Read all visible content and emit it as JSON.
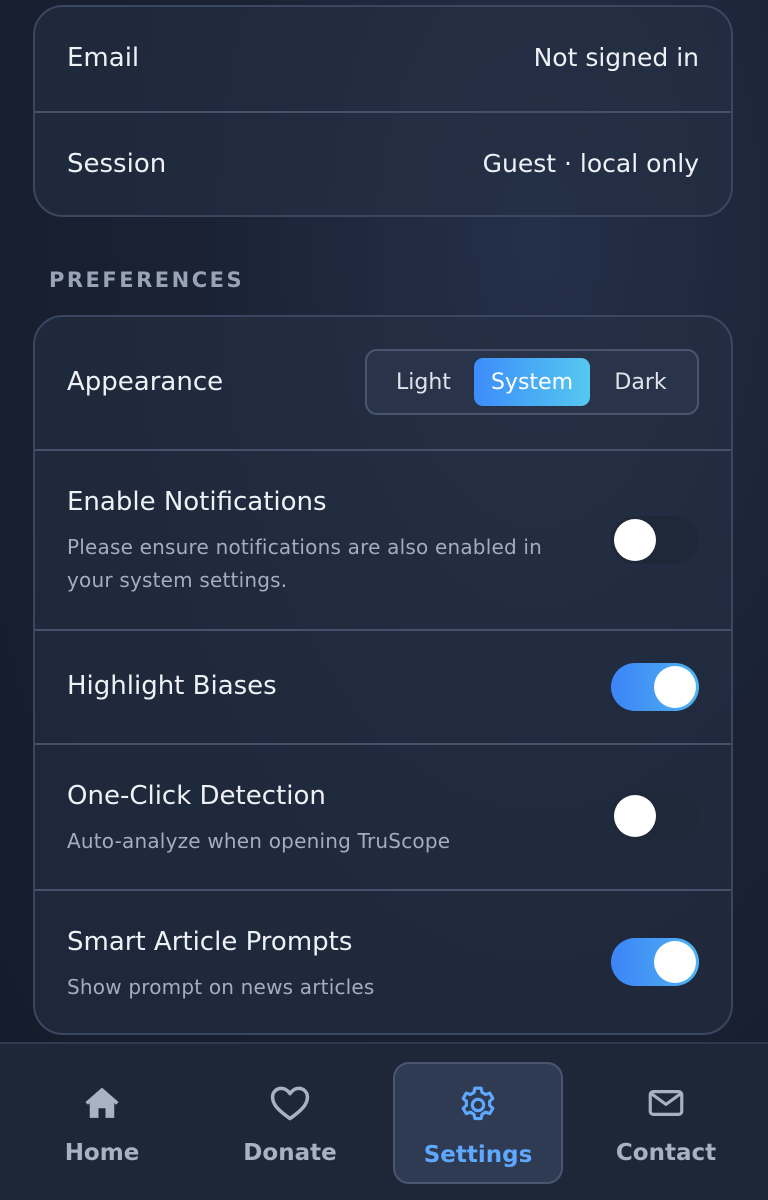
{
  "account": {
    "email_label": "Email",
    "email_value": "Not signed in",
    "session_label": "Session",
    "session_value": "Guest · local only"
  },
  "preferences": {
    "heading": "PREFERENCES",
    "appearance": {
      "label": "Appearance",
      "options": [
        "Light",
        "System",
        "Dark"
      ],
      "selected": "System"
    },
    "notifications": {
      "label": "Enable Notifications",
      "description": "Please ensure notifications are also enabled in your system settings.",
      "enabled": false
    },
    "highlight_biases": {
      "label": "Highlight Biases",
      "enabled": true
    },
    "one_click": {
      "label": "One-Click Detection",
      "description": "Auto-analyze when opening TruScope",
      "enabled": false
    },
    "smart_prompts": {
      "label": "Smart Article Prompts",
      "description": "Show prompt on news articles",
      "enabled": true
    }
  },
  "nav": {
    "items": [
      {
        "label": "Home",
        "icon": "home-icon"
      },
      {
        "label": "Donate",
        "icon": "heart-icon"
      },
      {
        "label": "Settings",
        "icon": "gear-icon"
      },
      {
        "label": "Contact",
        "icon": "mail-icon"
      }
    ],
    "active": "Settings"
  },
  "colors": {
    "accent": "#4f9bff",
    "toggle_on_start": "#3c84f7",
    "toggle_on_end": "#4fb3f2",
    "background": "#1a2234"
  }
}
